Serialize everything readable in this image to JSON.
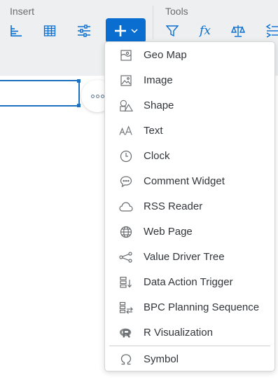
{
  "toolbar": {
    "insert_label": "Insert",
    "tools_label": "Tools",
    "insert_icons": [
      "chart-icon",
      "table-icon",
      "input-control-icon"
    ],
    "add_button": {
      "icon": "plus-icon",
      "caret": "chevron-down-icon"
    },
    "tools_icons": [
      "filter-icon",
      "formula-icon",
      "balance-icon",
      "sort-icon"
    ],
    "formula_text": "fx"
  },
  "menu": {
    "items": [
      {
        "label": "Geo Map",
        "icon": "geo-map-icon"
      },
      {
        "label": "Image",
        "icon": "image-icon"
      },
      {
        "label": "Shape",
        "icon": "shape-icon"
      },
      {
        "label": "Text",
        "icon": "text-icon"
      },
      {
        "label": "Clock",
        "icon": "clock-icon"
      },
      {
        "label": "Comment Widget",
        "icon": "comment-icon"
      },
      {
        "label": "RSS Reader",
        "icon": "cloud-icon"
      },
      {
        "label": "Web Page",
        "icon": "globe-icon"
      },
      {
        "label": "Value Driver Tree",
        "icon": "tree-icon"
      },
      {
        "label": "Data Action Trigger",
        "icon": "data-action-icon"
      },
      {
        "label": "BPC Planning Sequence",
        "icon": "planning-sequence-icon"
      },
      {
        "label": "R Visualization",
        "icon": "r-icon"
      },
      {
        "label": "Symbol",
        "icon": "omega-icon"
      }
    ]
  },
  "colors": {
    "accent": "#0a6ed1",
    "toolbar_bg": "#edeff0",
    "text": "#32363a",
    "icon_gray": "#6a6d70"
  }
}
